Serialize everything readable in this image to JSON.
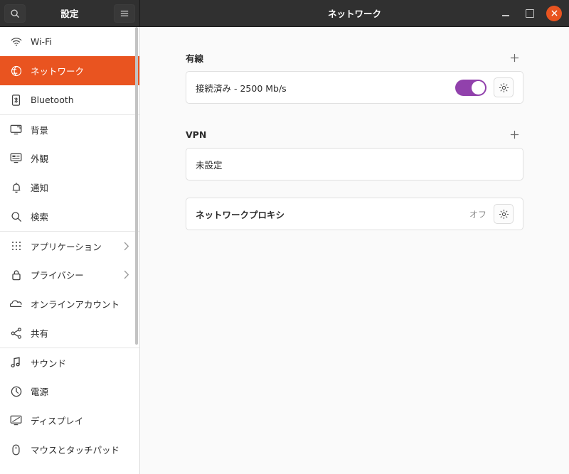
{
  "window": {
    "sidebar_title": "設定",
    "main_title": "ネットワーク",
    "search_icon": "search-icon",
    "menu_icon": "hamburger-menu-icon",
    "minimize_label": "最小化",
    "maximize_label": "最大化",
    "close_label": "閉じる",
    "accent_color": "#e95420",
    "headerbar_color": "#303030"
  },
  "sidebar": {
    "items": [
      {
        "label": "Wi-Fi",
        "icon": "wifi-icon",
        "selected": false,
        "chevron": false,
        "divider_top": false
      },
      {
        "label": "ネットワーク",
        "icon": "network-globe-icon",
        "selected": true,
        "chevron": false,
        "divider_top": false
      },
      {
        "label": "Bluetooth",
        "icon": "bluetooth-icon",
        "selected": false,
        "chevron": false,
        "divider_top": false
      },
      {
        "label": "背景",
        "icon": "wallpaper-icon",
        "selected": false,
        "chevron": false,
        "divider_top": true
      },
      {
        "label": "外観",
        "icon": "appearance-icon",
        "selected": false,
        "chevron": false,
        "divider_top": false
      },
      {
        "label": "通知",
        "icon": "bell-icon",
        "selected": false,
        "chevron": false,
        "divider_top": false
      },
      {
        "label": "検索",
        "icon": "search-icon",
        "selected": false,
        "chevron": false,
        "divider_top": false
      },
      {
        "label": "アプリケーション",
        "icon": "apps-grid-icon",
        "selected": false,
        "chevron": true,
        "divider_top": true
      },
      {
        "label": "プライバシー",
        "icon": "lock-icon",
        "selected": false,
        "chevron": true,
        "divider_top": false
      },
      {
        "label": "オンラインアカウント",
        "icon": "cloud-icon",
        "selected": false,
        "chevron": false,
        "divider_top": false
      },
      {
        "label": "共有",
        "icon": "share-nodes-icon",
        "selected": false,
        "chevron": false,
        "divider_top": false
      },
      {
        "label": "サウンド",
        "icon": "music-note-icon",
        "selected": false,
        "chevron": false,
        "divider_top": true
      },
      {
        "label": "電源",
        "icon": "power-icon",
        "selected": false,
        "chevron": false,
        "divider_top": false
      },
      {
        "label": "ディスプレイ",
        "icon": "display-monitor-icon",
        "selected": false,
        "chevron": false,
        "divider_top": false
      },
      {
        "label": "マウスとタッチパッド",
        "icon": "mouse-icon",
        "selected": false,
        "chevron": false,
        "divider_top": false
      }
    ]
  },
  "main": {
    "wired": {
      "title": "有線",
      "add_label": "+",
      "status": "接続済み - 2500 Mb/s",
      "toggle_on": true,
      "settings_icon": "gear-icon"
    },
    "vpn": {
      "title": "VPN",
      "add_label": "+",
      "status": "未設定"
    },
    "proxy": {
      "label": "ネットワークプロキシ",
      "value": "オフ",
      "settings_icon": "gear-icon"
    }
  }
}
